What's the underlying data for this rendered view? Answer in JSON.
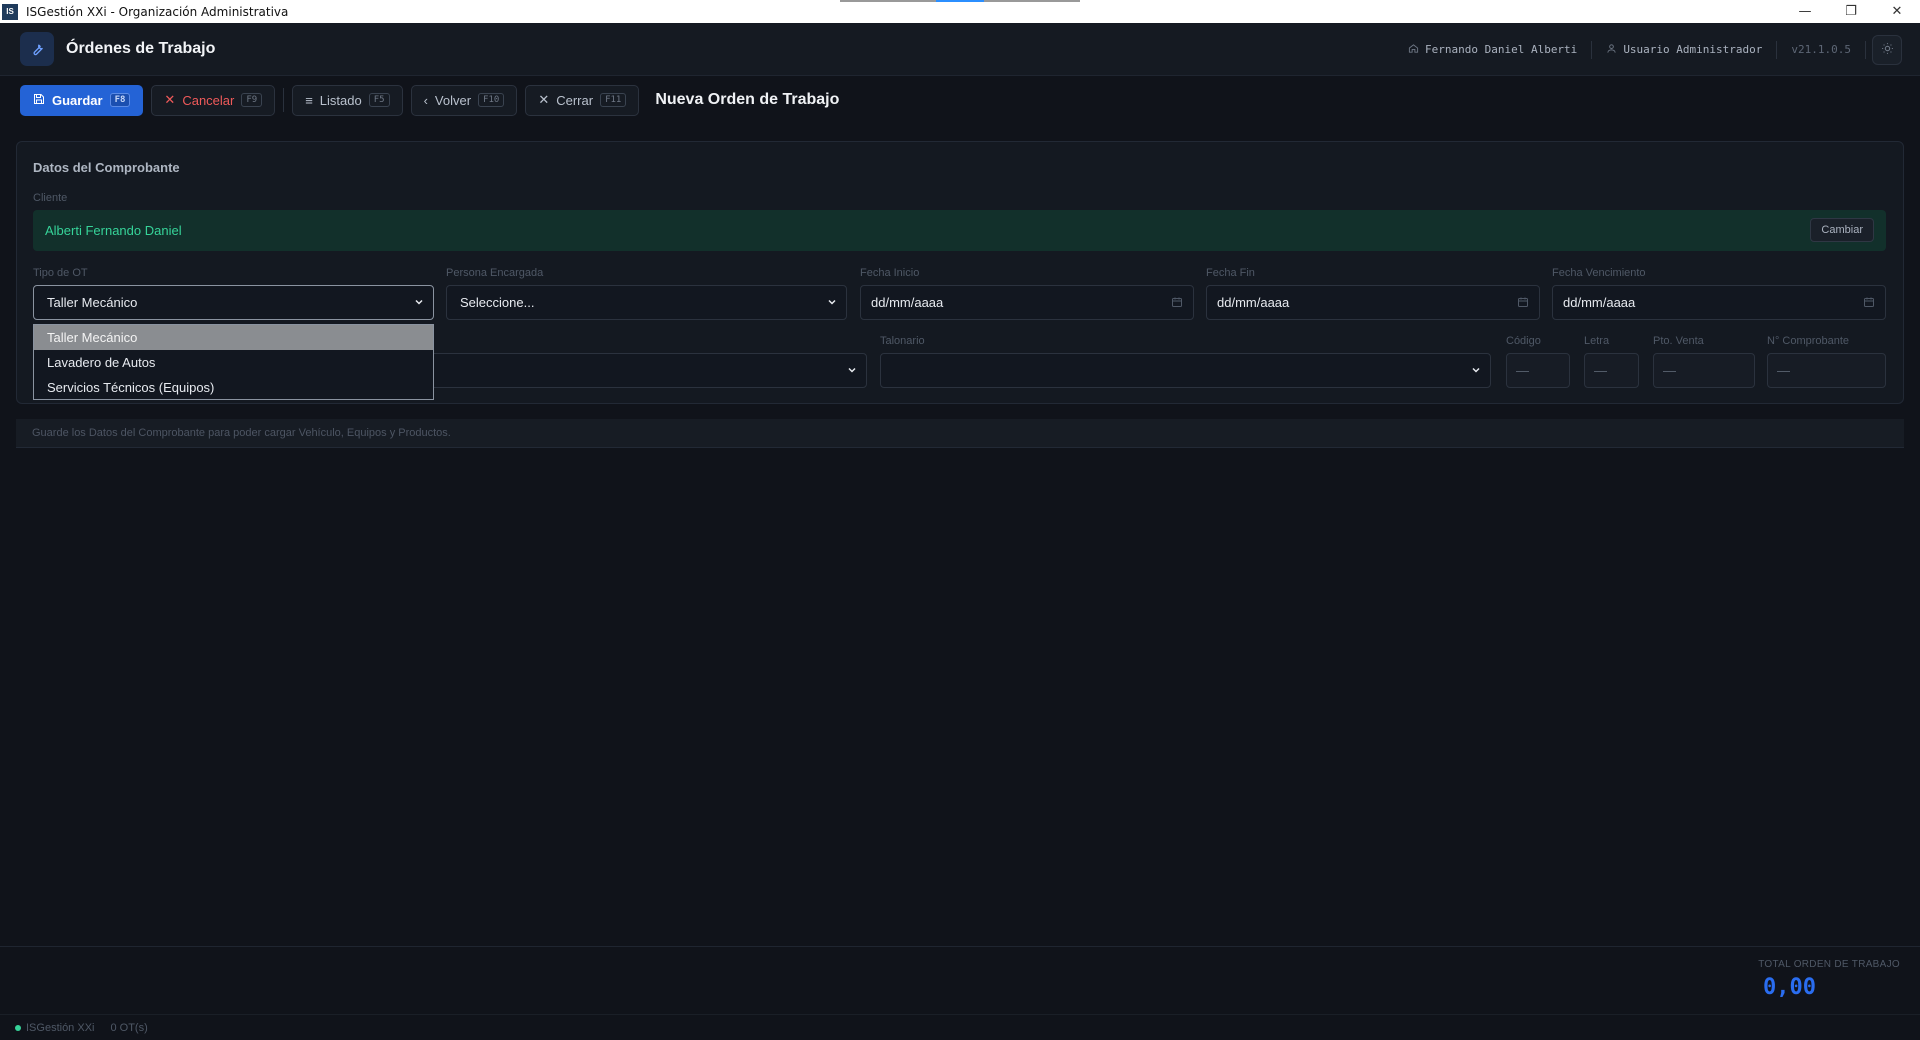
{
  "window": {
    "logo_text": "IS",
    "title": "ISGestión XXi - Organización Administrativa",
    "minimize": "—",
    "restore": "❐",
    "close": "✕"
  },
  "header": {
    "module_title": "Órdenes de Trabajo",
    "module_icon": "wrench-icon",
    "company": "Fernando Daniel Alberti",
    "user": "Usuario Administrador",
    "version": "v21.1.0.5"
  },
  "toolbar": {
    "save": {
      "label": "Guardar",
      "key": "F8"
    },
    "cancel": {
      "label": "Cancelar",
      "key": "F9"
    },
    "list": {
      "label": "Listado",
      "key": "F5"
    },
    "back": {
      "label": "Volver",
      "key": "F10"
    },
    "close": {
      "label": "Cerrar",
      "key": "F11"
    },
    "document_title": "Nueva Orden de Trabajo"
  },
  "form": {
    "section_title": "Datos del Comprobante",
    "client_label": "Cliente",
    "client_name": "Alberti Fernando Daniel",
    "change_button": "Cambiar",
    "tipo_ot": {
      "label": "Tipo de OT",
      "value": "Taller Mecánico",
      "options": [
        "Taller Mecánico",
        "Lavadero de Autos",
        "Servicios Técnicos (Equipos)"
      ],
      "highlighted_index": 0
    },
    "persona": {
      "label": "Persona Encargada",
      "value": "Seleccione..."
    },
    "fecha_inicio": {
      "label": "Fecha Inicio",
      "value": "dd/mm/aaaa"
    },
    "fecha_fin": {
      "label": "Fecha Fin",
      "value": "dd/mm/aaaa"
    },
    "fecha_vencimiento": {
      "label": "Fecha Vencimiento",
      "value": "dd/mm/aaaa"
    },
    "talonario": {
      "label": "Talonario",
      "value": ""
    },
    "codigo": {
      "label": "Código",
      "value": "—"
    },
    "letra": {
      "label": "Letra",
      "value": "—"
    },
    "pto_venta": {
      "label": "Pto. Venta",
      "value": "—"
    },
    "nro_comprobante": {
      "label": "N° Comprobante",
      "value": "—"
    }
  },
  "info_message": "Guarde los Datos del Comprobante para poder cargar Vehículo, Equipos y Productos.",
  "totals": {
    "label": "TOTAL ORDEN DE TRABAJO",
    "value": "0,00"
  },
  "status": {
    "app": "ISGestión XXi",
    "count": "0 OT(s)"
  },
  "colors": {
    "accent": "#2463d6",
    "success": "#36d399",
    "danger": "#ef5a5a",
    "background": "#10131a"
  }
}
